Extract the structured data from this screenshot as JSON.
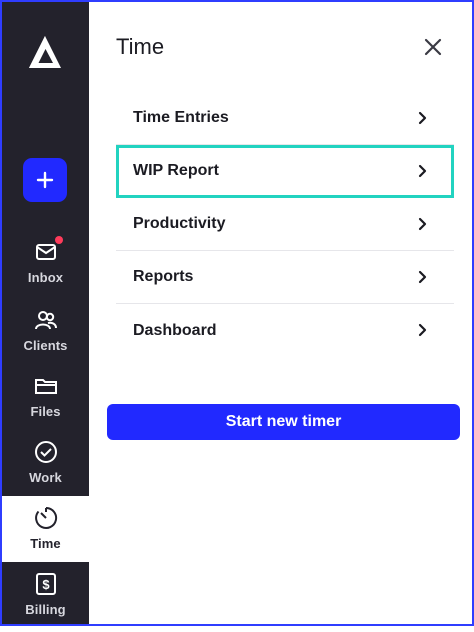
{
  "app": {
    "accent_color": "#2129ff",
    "sidebar_color": "#23222c",
    "highlight_color": "#22d3c0",
    "notification_color": "#ff3b5b"
  },
  "sidebar": {
    "logo_icon": "app-logo-icon",
    "add_icon": "plus-icon",
    "items": [
      {
        "label": "Inbox",
        "icon": "mail-icon",
        "has_notification": true
      },
      {
        "label": "Clients",
        "icon": "users-icon"
      },
      {
        "label": "Files",
        "icon": "folder-icon"
      },
      {
        "label": "Work",
        "icon": "check-circle-icon"
      },
      {
        "label": "Time",
        "icon": "timer-icon",
        "active": true
      },
      {
        "label": "Billing",
        "icon": "dollar-icon"
      }
    ]
  },
  "panel": {
    "title": "Time",
    "close_icon": "close-icon",
    "menu": [
      {
        "label": "Time Entries"
      },
      {
        "label": "WIP Report",
        "highlighted": true
      },
      {
        "label": "Productivity"
      },
      {
        "label": "Reports"
      },
      {
        "label": "Dashboard"
      }
    ],
    "primary_action": "Start new timer"
  }
}
